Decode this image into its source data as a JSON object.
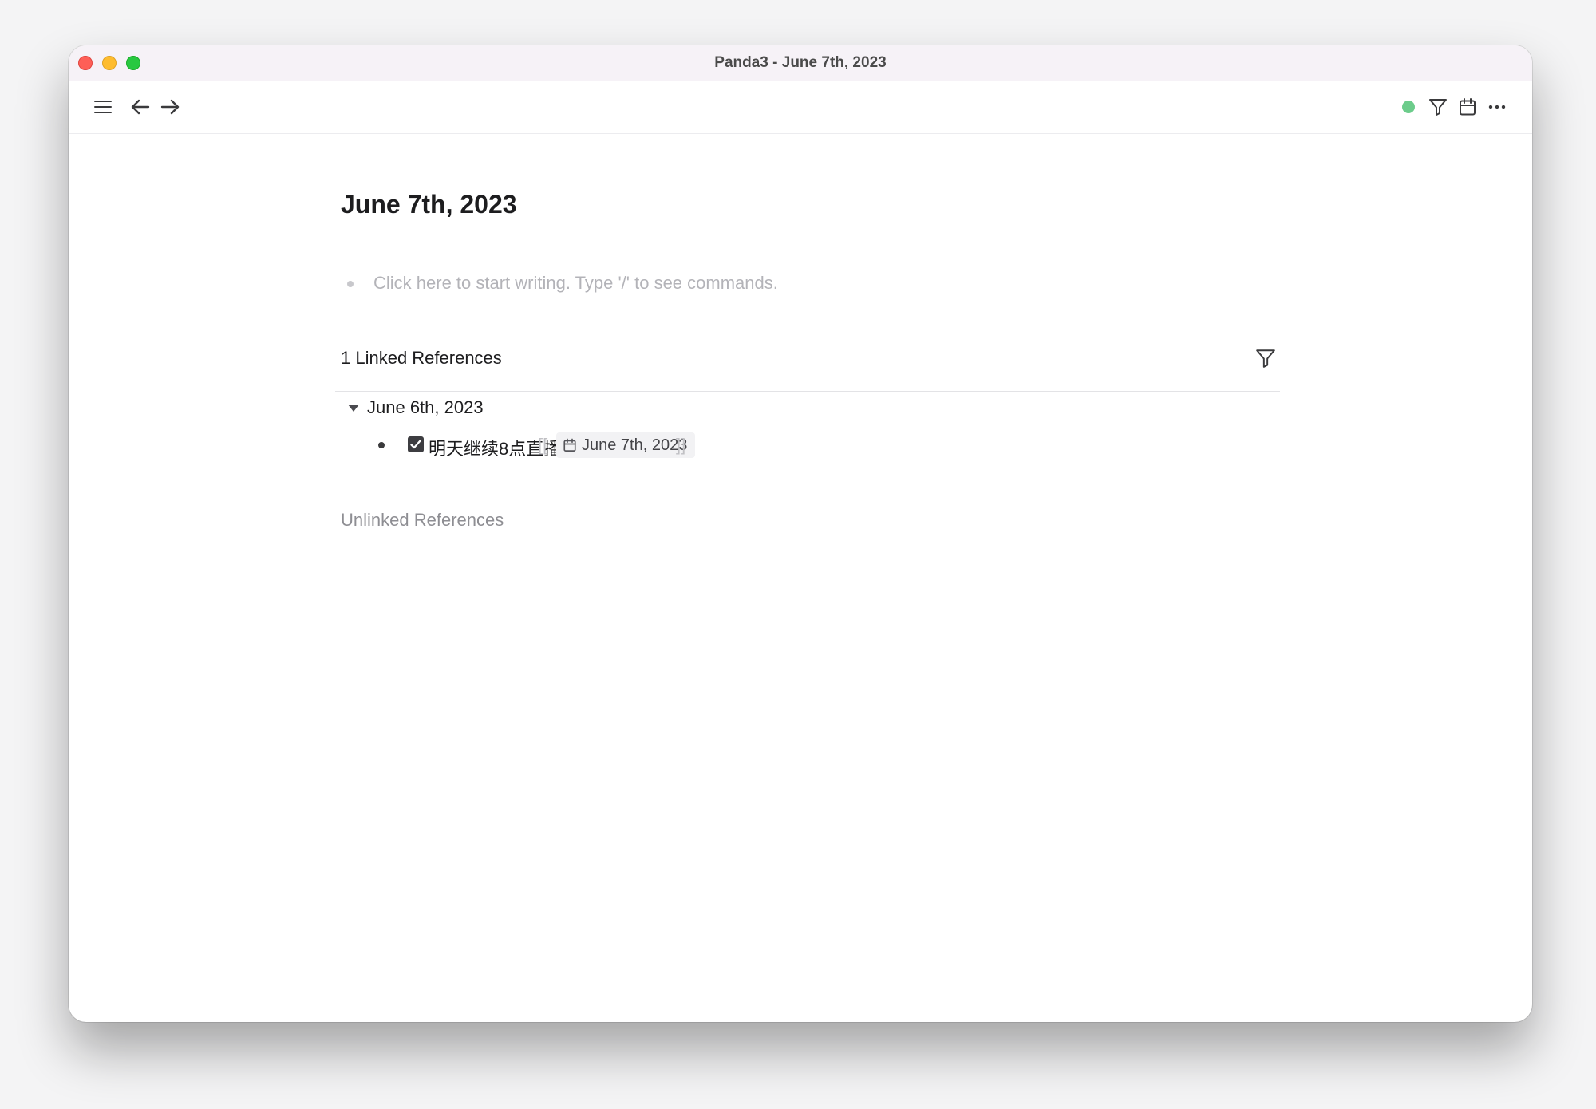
{
  "window": {
    "title": "Panda3 - June 7th, 2023"
  },
  "toolbar": {
    "icons": [
      "menu-icon",
      "arrow-left-icon",
      "arrow-right-icon",
      "filter-icon",
      "calendar-icon",
      "more-icon"
    ],
    "status_color": "#6ccc8b"
  },
  "page": {
    "title": "June 7th, 2023",
    "placeholder": "Click here to start writing. Type '/' to see commands."
  },
  "linked_references": {
    "title": "1 Linked References",
    "groups": [
      {
        "title": "June 6th, 2023",
        "items": [
          {
            "checked": true,
            "text": "明天继续8点直播",
            "bracket_open": "[[",
            "link": "June 7th, 2023",
            "bracket_close": "]]"
          }
        ]
      }
    ]
  },
  "unlinked_references": {
    "title": "Unlinked References"
  }
}
